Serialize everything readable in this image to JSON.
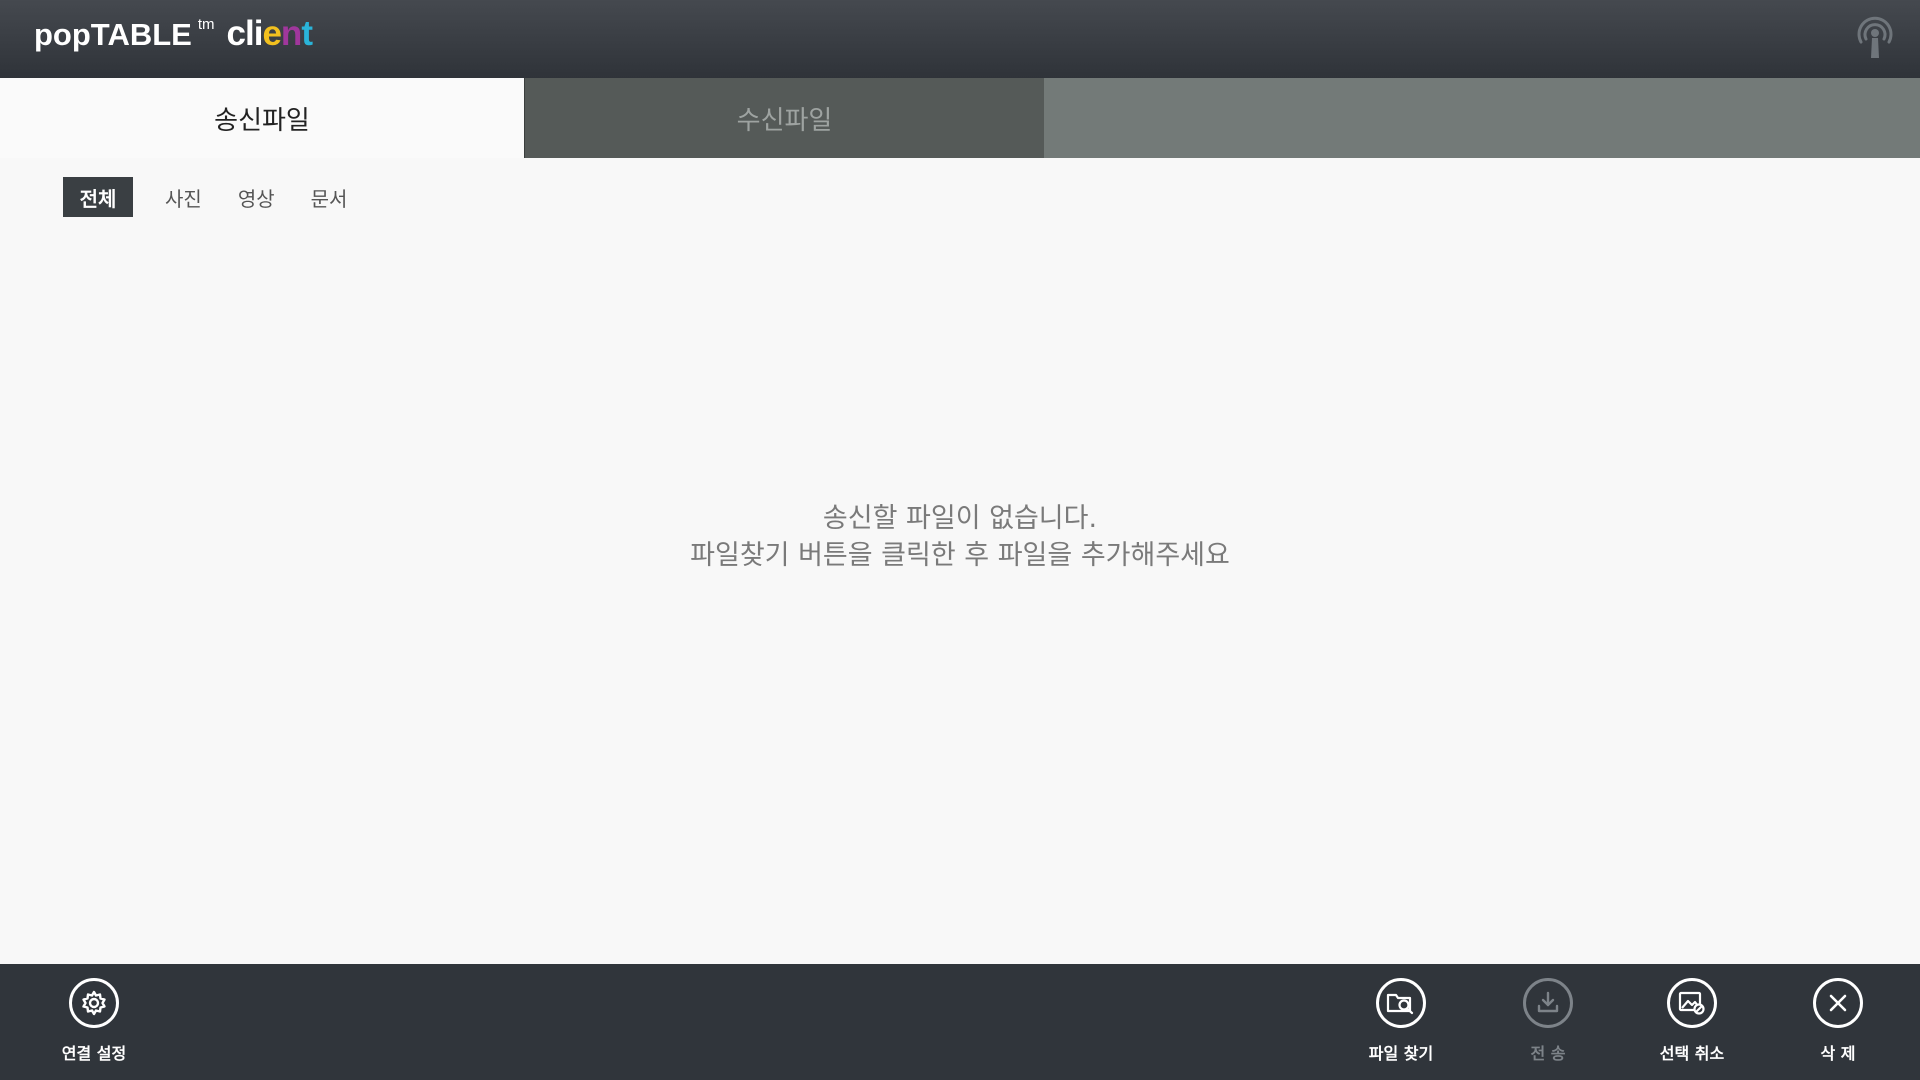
{
  "header": {
    "logo_main": "popTABLE",
    "logo_tm": "tm",
    "logo_sub_letters": [
      "c",
      "l",
      "i",
      "e",
      "n",
      "t"
    ],
    "status_icon": "antenna-icon"
  },
  "tabs": {
    "send_label": "송신파일",
    "receive_label": "수신파일",
    "active": "send"
  },
  "filters": {
    "items": [
      "전체",
      "사진",
      "영상",
      "문서"
    ],
    "active": "전체"
  },
  "empty_message": {
    "line1": "송신할 파일이 없습니다.",
    "line2": "파일찾기 버튼을 클릭한 후 파일을 추가해주세요"
  },
  "toolbar": {
    "connection_settings": {
      "label": "연결 설정",
      "icon": "gear-icon"
    },
    "find_file": {
      "label": "파일 찾기",
      "icon": "file-search-icon"
    },
    "send": {
      "label": "전 송",
      "icon": "download-icon",
      "disabled": true
    },
    "deselect": {
      "label": "선택 취소",
      "icon": "image-cancel-icon"
    },
    "delete": {
      "label": "삭 제",
      "icon": "close-icon"
    }
  },
  "colors": {
    "header_bg": "#35393f",
    "toolbar_bg": "#30353b",
    "tab_inactive_bg": "#555a58",
    "tab_bar_bg": "#737a78",
    "active_filter_bg": "#3a3f43",
    "logo_e": "#f2c01f",
    "logo_n": "#a0379c",
    "logo_t": "#2ab4d9"
  }
}
